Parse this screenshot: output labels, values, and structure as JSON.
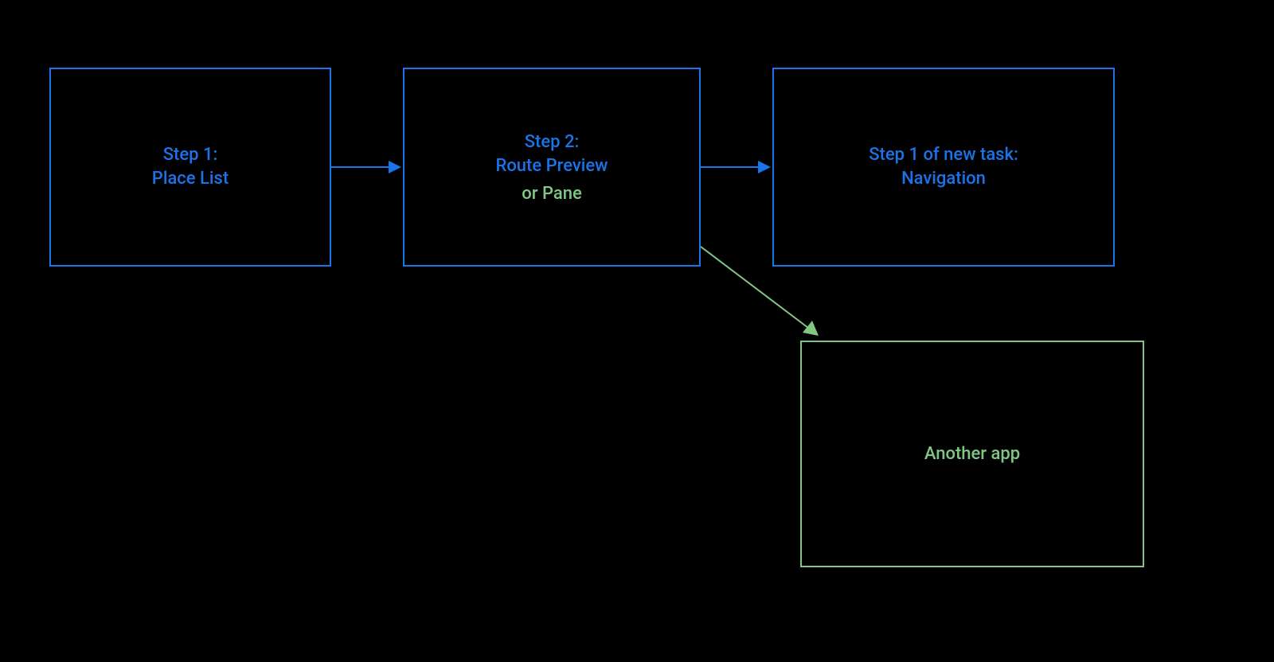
{
  "boxes": {
    "step1": {
      "title_line1": "Step 1:",
      "title_line2": "Place List"
    },
    "step2": {
      "title_line1": "Step 2:",
      "title_line2": "Route Preview",
      "subtitle": "or Pane"
    },
    "step1_new": {
      "title_line1": "Step 1 of new task:",
      "title_line2": "Navigation"
    },
    "another_app": {
      "title": "Another app"
    }
  },
  "colors": {
    "blue": "#1a73e8",
    "green": "#81c784",
    "background": "#000000"
  }
}
